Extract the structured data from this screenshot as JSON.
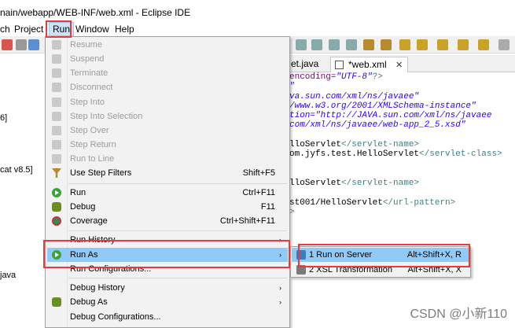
{
  "window": {
    "title": "nain/webapp/WEB-INF/web.xml - Eclipse IDE"
  },
  "menubar": [
    "ch",
    "Project",
    "Run",
    "Window",
    "Help"
  ],
  "explorer": {
    "fragments": [
      "6]",
      "cat v8.5]",
      "java"
    ]
  },
  "editor": {
    "tabs": [
      {
        "label": "et.java",
        "active": false
      },
      {
        "label": "*web.xml",
        "active": true,
        "close": "✕"
      }
    ],
    "lines": [
      [
        "encoding=",
        "\"UTF-8\"",
        "?>"
      ],
      [
        "\""
      ],
      [
        "va.sun.com/xml/ns/javaee\""
      ],
      [
        "/www.w3.org/2001/XMLSchema-instance\""
      ],
      [
        "tion=\"http://JAVA.sun.com/xml/ns/javaee"
      ],
      [
        "com/xml/ns/javaee/web-app_2_5.xsd\""
      ],
      [],
      [
        "lloServlet",
        "</servlet-name>"
      ],
      [
        "om.jyfs.test.HelloServlet",
        "</servlet-class>"
      ],
      [],
      [],
      [
        "lloServlet",
        "</servlet-name>"
      ],
      [],
      [
        "st001/HelloServlet",
        "</url-pattern>"
      ],
      [
        ">"
      ]
    ]
  },
  "run_menu": {
    "items": [
      {
        "label": "Resume",
        "shortcut": "",
        "disabled": true,
        "icon": "resume-icon"
      },
      {
        "label": "Suspend",
        "shortcut": "",
        "disabled": true,
        "icon": "suspend-icon"
      },
      {
        "label": "Terminate",
        "shortcut": "",
        "disabled": true,
        "icon": "terminate-icon"
      },
      {
        "label": "Disconnect",
        "shortcut": "",
        "disabled": true,
        "icon": "disconnect-icon"
      },
      {
        "label": "Step Into",
        "shortcut": "",
        "disabled": true,
        "icon": "step-into-icon"
      },
      {
        "label": "Step Into Selection",
        "shortcut": "",
        "disabled": true,
        "icon": "step-into-selection-icon"
      },
      {
        "label": "Step Over",
        "shortcut": "",
        "disabled": true,
        "icon": "step-over-icon"
      },
      {
        "label": "Step Return",
        "shortcut": "",
        "disabled": true,
        "icon": "step-return-icon"
      },
      {
        "label": "Run to Line",
        "shortcut": "",
        "disabled": true,
        "icon": "run-to-line-icon"
      },
      {
        "label": "Use Step Filters",
        "shortcut": "Shift+F5",
        "disabled": false,
        "icon": "step-filter-icon"
      },
      {
        "label": "Run",
        "shortcut": "Ctrl+F11",
        "disabled": false,
        "icon": "run-icon"
      },
      {
        "label": "Debug",
        "shortcut": "F11",
        "disabled": false,
        "icon": "debug-icon"
      },
      {
        "label": "Coverage",
        "shortcut": "Ctrl+Shift+F11",
        "disabled": false,
        "icon": "coverage-icon"
      },
      {
        "label": "Run History",
        "shortcut": "",
        "disabled": false,
        "submenu": true
      },
      {
        "label": "Run As",
        "shortcut": "",
        "disabled": false,
        "submenu": true,
        "highlighted": true,
        "icon": "run-as-icon"
      },
      {
        "label": "Run Configurations...",
        "shortcut": "",
        "disabled": false
      },
      {
        "label": "Debug History",
        "shortcut": "",
        "disabled": false,
        "submenu": true
      },
      {
        "label": "Debug As",
        "shortcut": "",
        "disabled": false,
        "submenu": true,
        "icon": "debug-as-icon"
      },
      {
        "label": "Debug Configurations...",
        "shortcut": "",
        "disabled": false
      }
    ],
    "submenu_arrow": "›"
  },
  "run_as_submenu": {
    "items": [
      {
        "label": "1 Run on Server",
        "shortcut": "Alt+Shift+X, R",
        "highlighted": true,
        "icon": "server-icon"
      },
      {
        "label": "2 XSL Transformation",
        "shortcut": "Alt+Shift+X, X",
        "highlighted": false,
        "icon": "xsl-icon"
      }
    ]
  },
  "watermark": {
    "text": "CSDN @小新110"
  }
}
